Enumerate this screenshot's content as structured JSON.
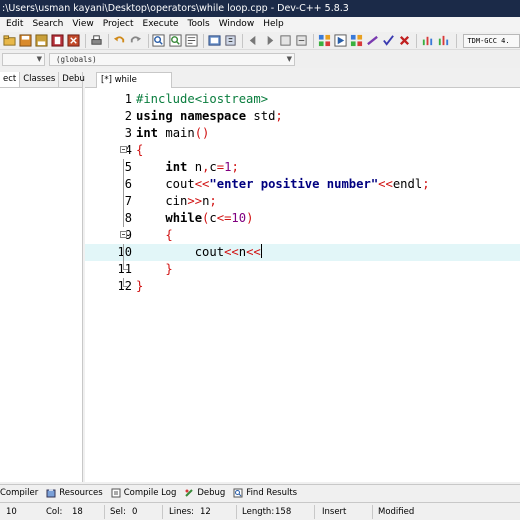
{
  "window": {
    "title": ":\\Users\\usman kayani\\Desktop\\operators\\while loop.cpp - Dev-C++ 5.8.3"
  },
  "menubar": {
    "items": [
      "Edit",
      "Search",
      "View",
      "Project",
      "Execute",
      "Tools",
      "Window",
      "Help"
    ]
  },
  "toolbar": {
    "compiler": "TDM-GCC 4."
  },
  "scopebar": {
    "scope": "(globals)"
  },
  "left_panel": {
    "tabs": [
      "ect",
      "Classes",
      "Debug"
    ]
  },
  "editor": {
    "tab_label": "[*] while loop.cpp",
    "current_line": 10,
    "lines": [
      {
        "num": "1",
        "text": "#include<iostream>"
      },
      {
        "num": "2",
        "text": "using namespace std;"
      },
      {
        "num": "3",
        "text": "int main()"
      },
      {
        "num": "4",
        "text": "{"
      },
      {
        "num": "5",
        "text": "    int n,c=1;"
      },
      {
        "num": "6",
        "text": "    cout<<\"enter positive number\"<<endl;"
      },
      {
        "num": "7",
        "text": "    cin>>n;"
      },
      {
        "num": "8",
        "text": "    while(c<=10)"
      },
      {
        "num": "9",
        "text": "    {"
      },
      {
        "num": "10",
        "text": "        cout<<n<<"
      },
      {
        "num": "11",
        "text": "    }"
      },
      {
        "num": "12",
        "text": "}"
      }
    ]
  },
  "bottom_tabs": {
    "items": [
      "Compiler",
      "Resources",
      "Compile Log",
      "Debug",
      "Find Results"
    ]
  },
  "statusbar": {
    "line_value": "10",
    "col_label": "Col:",
    "col_value": "18",
    "sel_label": "Sel:",
    "sel_value": "0",
    "lines_label": "Lines:",
    "lines_value": "12",
    "length_label": "Length:",
    "length_value": "158",
    "mode": "Insert",
    "state": "Modified"
  },
  "colors": {
    "titlebar": "#1b2a48",
    "current_line_highlight": "#e2f6f8",
    "preprocessor": "#0a7d3e",
    "symbol": "#d01010",
    "string": "#000080",
    "number": "#800080"
  }
}
